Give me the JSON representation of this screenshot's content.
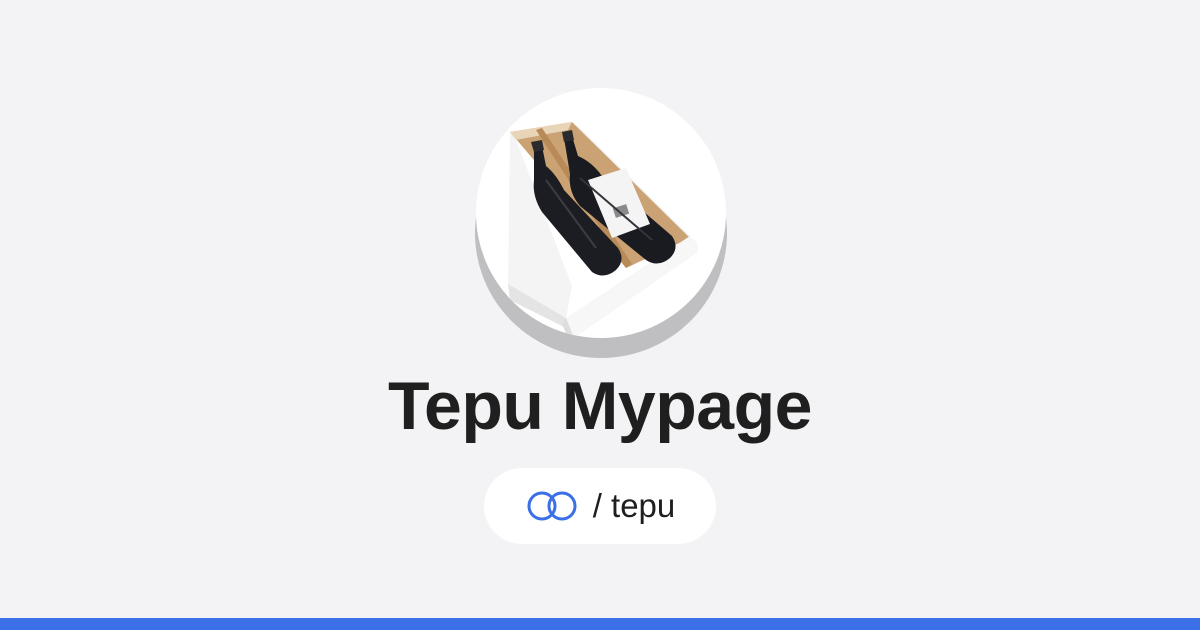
{
  "profile": {
    "title": "Tepu Mypage",
    "avatar_alt": "wine bottles in a white box",
    "handle": {
      "separator": "/",
      "username": "tepu",
      "display": "/ tepu",
      "icon": "linked-rings-icon"
    }
  },
  "colors": {
    "background": "#f3f3f5",
    "accent": "#3b6fe8",
    "title_text": "#1f1f1f",
    "pill_background": "#ffffff"
  }
}
